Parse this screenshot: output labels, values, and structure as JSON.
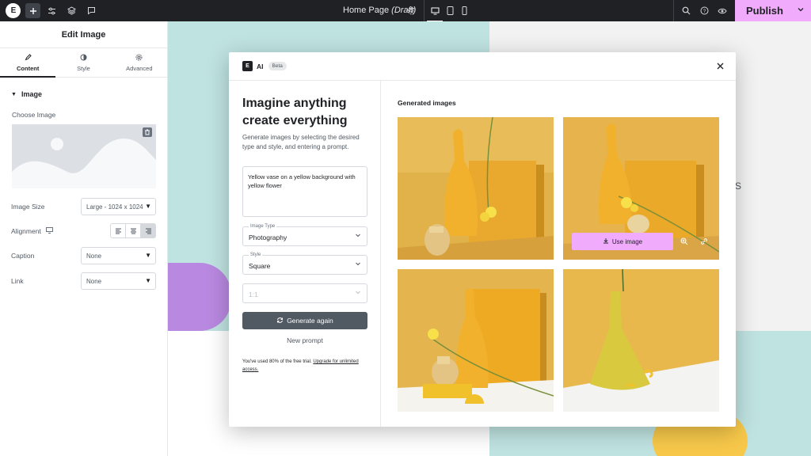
{
  "topbar": {
    "logo_text": "E",
    "page_title": "Home Page",
    "page_status": "(Draft)",
    "publish_label": "Publish",
    "icons": [
      "add-icon",
      "settings-sliders-icon",
      "layers-icon",
      "comment-icon",
      "gear-icon",
      "desktop-icon",
      "tablet-icon",
      "mobile-icon",
      "search-icon",
      "help-icon",
      "eye-icon",
      "chevron-down-icon"
    ]
  },
  "panel": {
    "title": "Edit Image",
    "tabs": [
      {
        "label": "Content",
        "icon": "pencil-icon",
        "active": true
      },
      {
        "label": "Style",
        "icon": "half-circle-icon",
        "active": false
      },
      {
        "label": "Advanced",
        "icon": "gear-icon",
        "active": false
      }
    ],
    "section": "Image",
    "choose_image_label": "Choose Image",
    "image_size_label": "Image Size",
    "image_size_value": "Large - 1024 x 1024",
    "alignment_label": "Alignment",
    "caption_label": "Caption",
    "caption_value": "None",
    "link_label": "Link",
    "link_value": "None"
  },
  "canvas": {
    "peek_text": "S"
  },
  "modal": {
    "ai_logo": "E",
    "ai_label": "AI",
    "beta_label": "Beta",
    "heading": "Imagine anything create everything",
    "description": "Generate images by selecting the desired type and style, and entering a prompt.",
    "prompt": "Yellow vase on a yellow background with yellow flower",
    "image_type_label": "Image Type",
    "image_type_value": "Photography",
    "style_label": "Style",
    "style_value": "Square",
    "ratio_value": "1:1",
    "generate_label": "Generate again",
    "new_prompt_label": "New prompt",
    "usage_text": "You've used 80% of the free trial.",
    "upgrade_link": "Upgrade for unlimited access.",
    "generated_title": "Generated images",
    "use_image_label": "Use image"
  },
  "colors": {
    "accent_pink": "#f0abfc",
    "topbar": "#1f2124",
    "button_gray": "#515962",
    "teal": "#bfe3e1",
    "mustard": "#e8b23a"
  }
}
